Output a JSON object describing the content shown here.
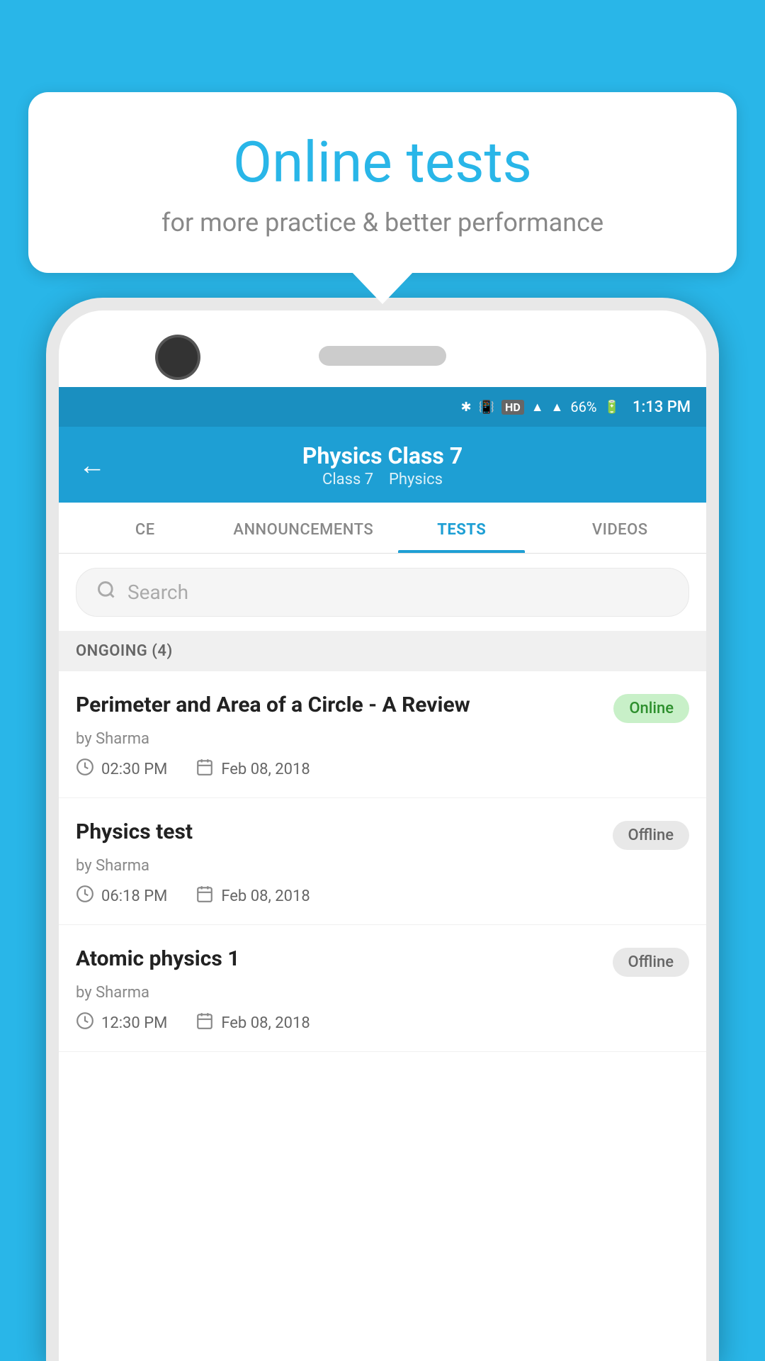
{
  "tooltip": {
    "title": "Online tests",
    "subtitle": "for more practice & better performance"
  },
  "status_bar": {
    "time": "1:13 PM",
    "battery": "66%"
  },
  "app_bar": {
    "title": "Physics Class 7",
    "subtitle_class": "Class 7",
    "subtitle_subject": "Physics",
    "back_label": "←"
  },
  "tabs": [
    {
      "label": "CE",
      "active": false
    },
    {
      "label": "ANNOUNCEMENTS",
      "active": false
    },
    {
      "label": "TESTS",
      "active": true
    },
    {
      "label": "VIDEOS",
      "active": false
    }
  ],
  "search": {
    "placeholder": "Search"
  },
  "section": {
    "label": "ONGOING (4)"
  },
  "tests": [
    {
      "title": "Perimeter and Area of a Circle - A Review",
      "author": "by Sharma",
      "time": "02:30 PM",
      "date": "Feb 08, 2018",
      "status": "Online",
      "status_type": "online"
    },
    {
      "title": "Physics test",
      "author": "by Sharma",
      "time": "06:18 PM",
      "date": "Feb 08, 2018",
      "status": "Offline",
      "status_type": "offline"
    },
    {
      "title": "Atomic physics 1",
      "author": "by Sharma",
      "time": "12:30 PM",
      "date": "Feb 08, 2018",
      "status": "Offline",
      "status_type": "offline"
    }
  ]
}
